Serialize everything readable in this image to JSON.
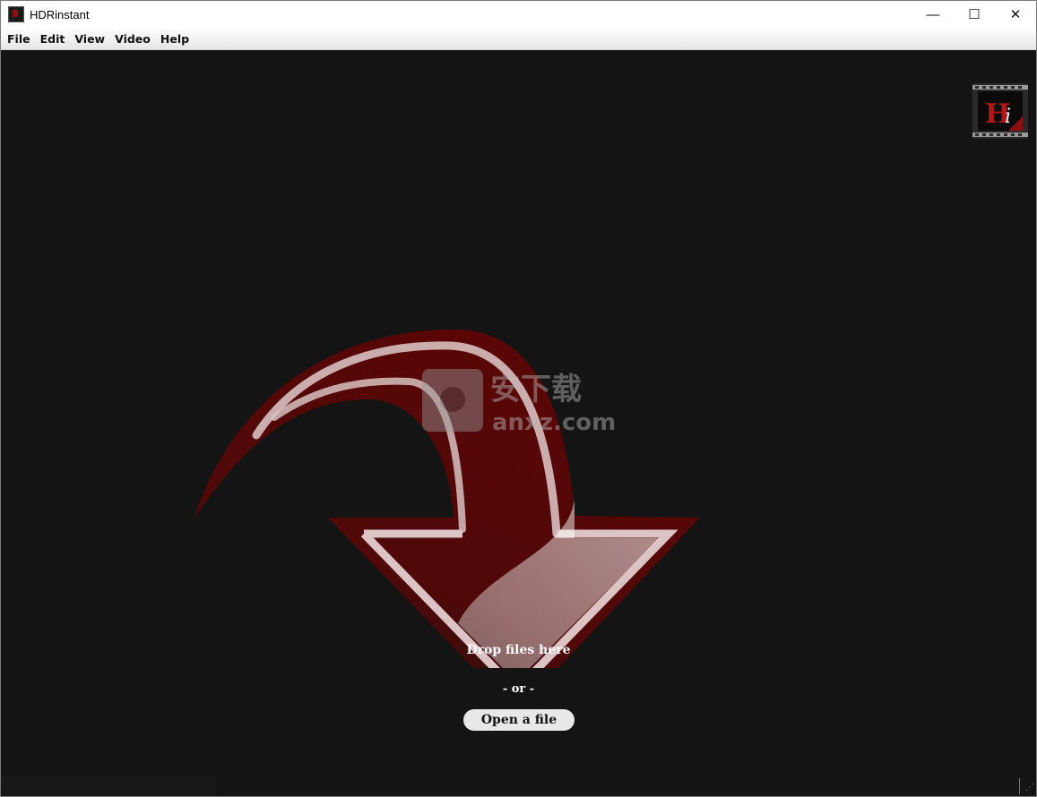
{
  "window": {
    "title": "HDRinstant",
    "controls": {
      "minimize": "—",
      "maximize": "☐",
      "close": "✕"
    }
  },
  "menu": [
    {
      "label": "File"
    },
    {
      "label": "Edit"
    },
    {
      "label": "View"
    },
    {
      "label": "Video"
    },
    {
      "label": "Help"
    }
  ],
  "logo": {
    "text": "Hi"
  },
  "watermark": {
    "line1": "安下载",
    "line2": "anxz.com"
  },
  "dropzone": {
    "drop_text": "Drop files here",
    "or_text": "- or -",
    "open_button": "Open a file"
  },
  "colors": {
    "background": "#141414",
    "arrow_dark": "#5a0606",
    "arrow_outline": "#d9b8b8"
  }
}
